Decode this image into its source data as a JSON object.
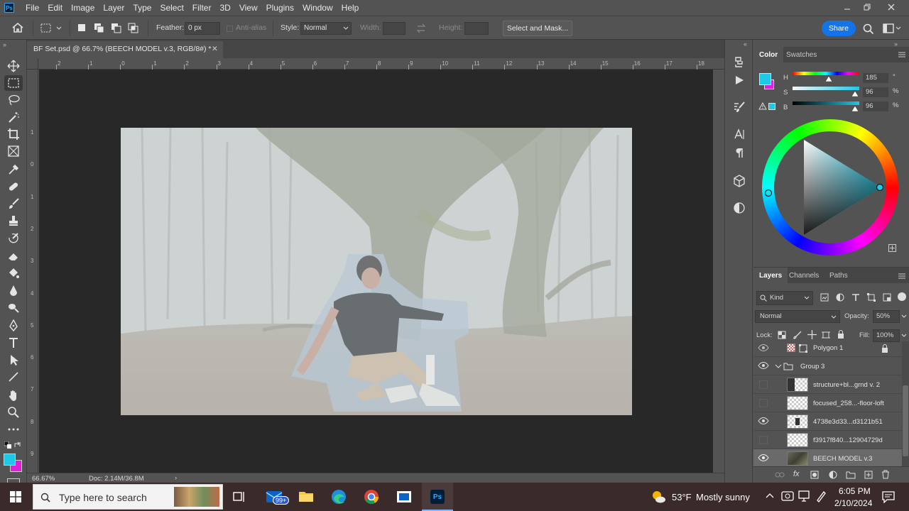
{
  "menubar": {
    "logo": "Ps",
    "items": [
      "File",
      "Edit",
      "Image",
      "Layer",
      "Type",
      "Select",
      "Filter",
      "3D",
      "View",
      "Plugins",
      "Window",
      "Help"
    ],
    "window_controls": [
      "minimize",
      "restore",
      "close"
    ]
  },
  "options": {
    "feather_label": "Feather:",
    "feather_value": "0 px",
    "antialias_label": "Anti-alias",
    "style_label": "Style:",
    "style_value": "Normal",
    "width_label": "Width:",
    "height_label": "Height:",
    "select_mask_label": "Select and Mask...",
    "share_label": "Share"
  },
  "document": {
    "tab_title": "BF Set.psd @ 66.7% (BEECH MODEL v.3, RGB/8#) *",
    "zoom": "66.67%",
    "doc_info": "Doc: 2.14M/36.8M",
    "ruler_top": [
      "2",
      "1",
      "0",
      "1",
      "2",
      "3",
      "4",
      "5",
      "6",
      "7",
      "8",
      "9",
      "10",
      "11",
      "12",
      "13",
      "14",
      "15",
      "16",
      "17",
      "18"
    ],
    "ruler_left": [
      "1",
      "0",
      "1",
      "2",
      "3",
      "4",
      "5",
      "6",
      "7",
      "8",
      "9"
    ]
  },
  "color_panel": {
    "tabs": [
      "Color",
      "Swatches"
    ],
    "h_label": "H",
    "h_value": "185",
    "h_unit": "°",
    "s_label": "S",
    "s_value": "96",
    "s_unit": "%",
    "b_label": "B",
    "b_value": "96",
    "b_unit": "%",
    "foreground": "#1ec9e8",
    "background": "#e020d8"
  },
  "layers_panel": {
    "tabs": [
      "Layers",
      "Channels",
      "Paths"
    ],
    "kind_label": "Kind",
    "blend_mode": "Normal",
    "opacity_label": "Opacity:",
    "opacity_value": "50%",
    "lock_label": "Lock:",
    "fill_label": "Fill:",
    "fill_value": "100%",
    "layers": [
      {
        "name": "Polygon 1",
        "visible": true,
        "locked": true
      },
      {
        "name": "Group 3",
        "visible": true,
        "group": true
      },
      {
        "name": "structure+bl...grnd  v. 2",
        "visible": false
      },
      {
        "name": "focused_258...-floor-loft",
        "visible": false
      },
      {
        "name": "4738e3d33...d3121b51",
        "visible": true
      },
      {
        "name": "f3917f840...12904729d",
        "visible": false
      },
      {
        "name": "BEECH MODEL v.3",
        "visible": true,
        "selected": true
      }
    ]
  },
  "taskbar": {
    "search_placeholder": "Type here to search",
    "mail_badge": "99+",
    "temperature": "53°F",
    "weather": "Mostly sunny",
    "time": "6:05 PM",
    "date": "2/10/2024"
  }
}
